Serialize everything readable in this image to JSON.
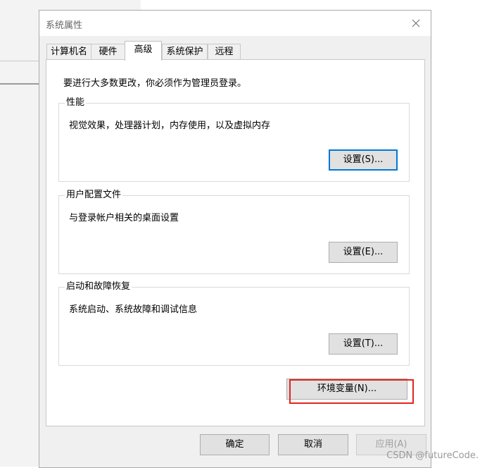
{
  "dialog": {
    "title": "系统属性"
  },
  "tabs": [
    {
      "label": "计算机名"
    },
    {
      "label": "硬件"
    },
    {
      "label": "高级"
    },
    {
      "label": "系统保护"
    },
    {
      "label": "远程"
    }
  ],
  "active_tab": "高级",
  "intro": "要进行大多数更改，你必须作为管理员登录。",
  "groups": {
    "performance": {
      "title": "性能",
      "desc": "视觉效果，处理器计划，内存使用，以及虚拟内存",
      "button": "设置(S)..."
    },
    "user_profiles": {
      "title": "用户配置文件",
      "desc": "与登录帐户相关的桌面设置",
      "button": "设置(E)..."
    },
    "startup_recovery": {
      "title": "启动和故障恢复",
      "desc": "系统启动、系统故障和调试信息",
      "button": "设置(T)..."
    }
  },
  "env_button": "环境变量(N)...",
  "footer": {
    "ok": "确定",
    "cancel": "取消",
    "apply": "应用(A)"
  },
  "watermark": "CSDN @futureCode.",
  "colors": {
    "highlight": "#e0261c",
    "focus": "#0078d7"
  }
}
